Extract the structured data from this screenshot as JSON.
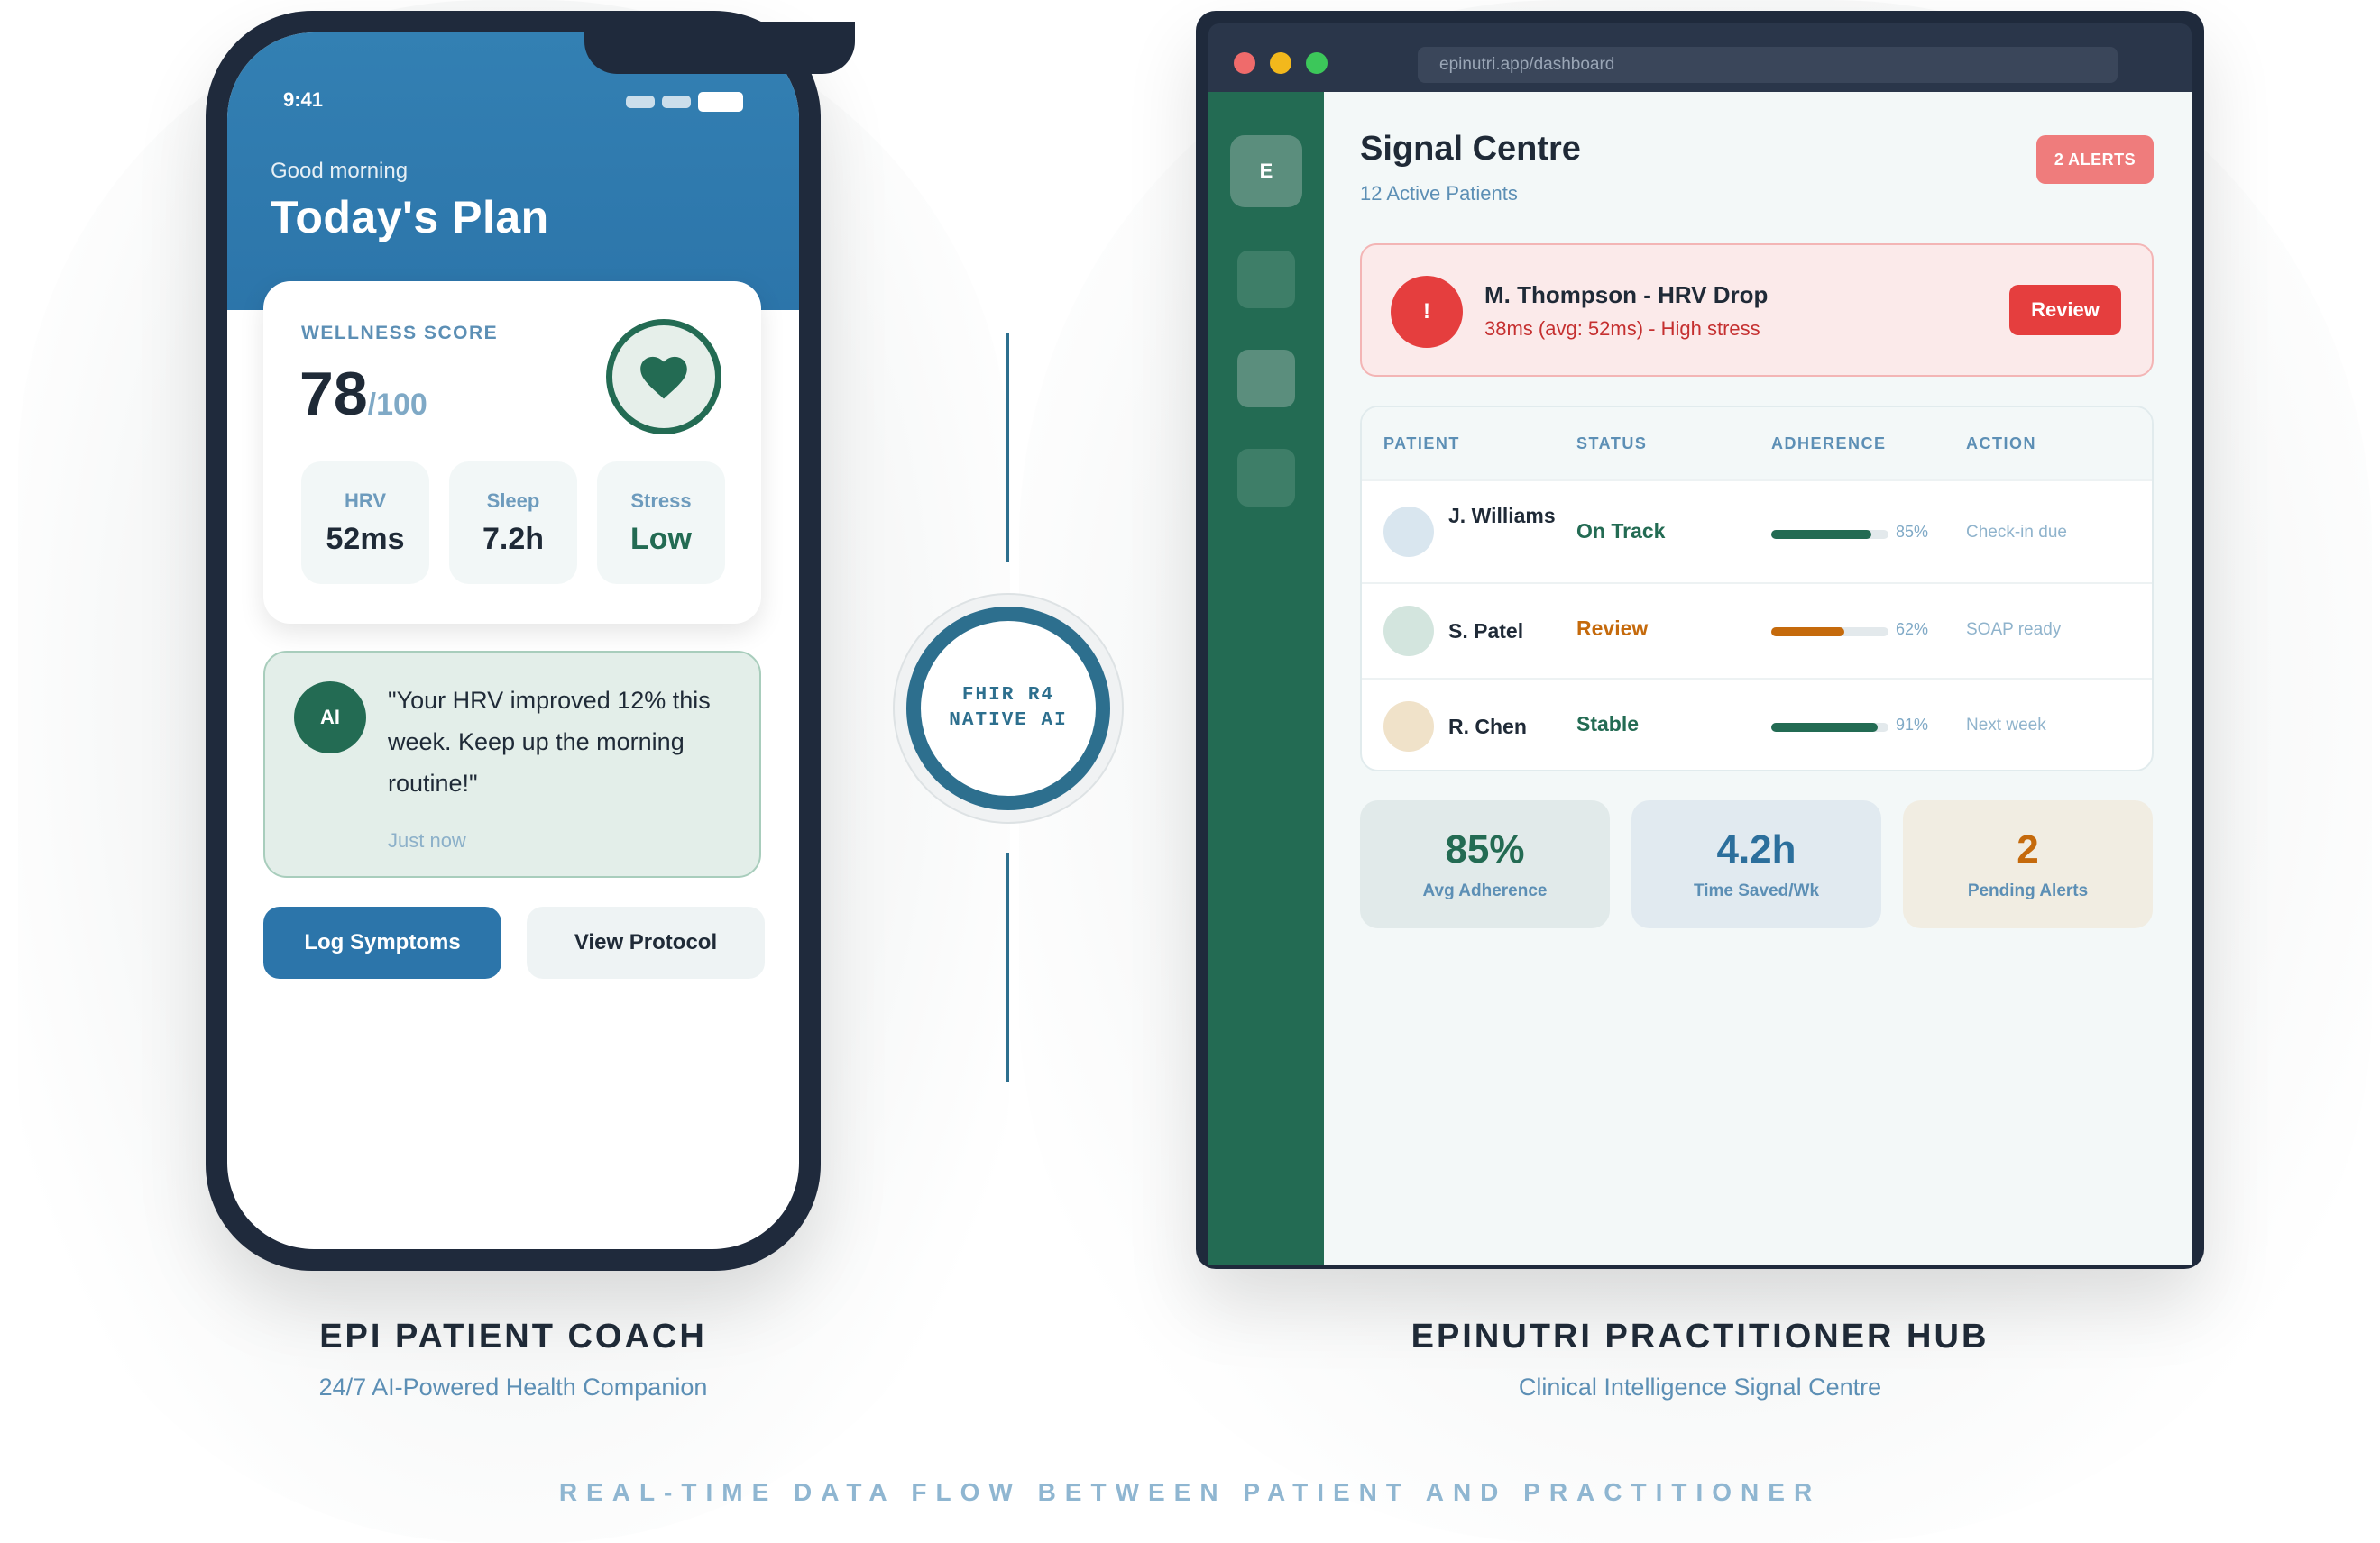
{
  "phone": {
    "status_time": "9:41",
    "greeting": "Good morning",
    "title": "Today's Plan",
    "wellness": {
      "label": "WELLNESS SCORE",
      "score": "78",
      "max": "/100"
    },
    "metrics": [
      {
        "label": "HRV",
        "value": "52ms"
      },
      {
        "label": "Sleep",
        "value": "7.2h"
      },
      {
        "label": "Stress",
        "value": "Low"
      }
    ],
    "ai_message": {
      "avatar": "AI",
      "quote": "\"Your HRV improved 12% this week. Keep up the morning routine!\"",
      "time": "Just now"
    },
    "buttons": {
      "log": "Log Symptoms",
      "protocol": "View Protocol"
    },
    "caption_title": "EPI PATIENT COACH",
    "caption_sub": "24/7 AI-Powered Health Companion"
  },
  "connector": {
    "line1": "FHIR R4",
    "line2": "NATIVE AI"
  },
  "browser": {
    "url": "epinutri.app/dashboard",
    "sidebar_logo": "E",
    "title": "Signal Centre",
    "subtitle": "12 Active Patients",
    "alerts_badge": "2 ALERTS",
    "alert": {
      "icon": "!",
      "name": "M. Thompson - HRV Drop",
      "detail": "38ms (avg: 52ms) - High stress",
      "button": "Review"
    },
    "table": {
      "headers": [
        "PATIENT",
        "STATUS",
        "ADHERENCE",
        "ACTION"
      ],
      "rows": [
        {
          "name": "J. Williams",
          "status": "On Track",
          "adherence": 85,
          "adherence_label": "85%",
          "action": "Check-in due",
          "status_color": "#236b53",
          "bar_color": "#236b53",
          "avatar_color": "#d9e6ef"
        },
        {
          "name": "S. Patel",
          "status": "Review",
          "adherence": 62,
          "adherence_label": "62%",
          "action": "SOAP ready",
          "status_color": "#c56a0c",
          "bar_color": "#c56a0c",
          "avatar_color": "#d3e5de"
        },
        {
          "name": "R. Chen",
          "status": "Stable",
          "adherence": 91,
          "adherence_label": "91%",
          "action": "Next week",
          "status_color": "#236b53",
          "bar_color": "#236b53",
          "avatar_color": "#f0e2c9"
        }
      ]
    },
    "stats": [
      {
        "value": "85%",
        "label": "Avg Adherence",
        "color": "#236b53",
        "bg": "#e1eaea"
      },
      {
        "value": "4.2h",
        "label": "Time Saved/Wk",
        "color": "#2c6f9c",
        "bg": "#e1eaf0"
      },
      {
        "value": "2",
        "label": "Pending Alerts",
        "color": "#c56a0c",
        "bg": "#f1ede2"
      }
    ],
    "caption_title": "EPINUTRI PRACTITIONER HUB",
    "caption_sub": "Clinical Intelligence Signal Centre"
  },
  "footer": "REAL-TIME DATA FLOW BETWEEN PATIENT AND PRACTITIONER",
  "colors": {
    "brand_blue": "#2c75aa",
    "brand_green": "#236b53",
    "alert_red": "#e53e3e"
  }
}
